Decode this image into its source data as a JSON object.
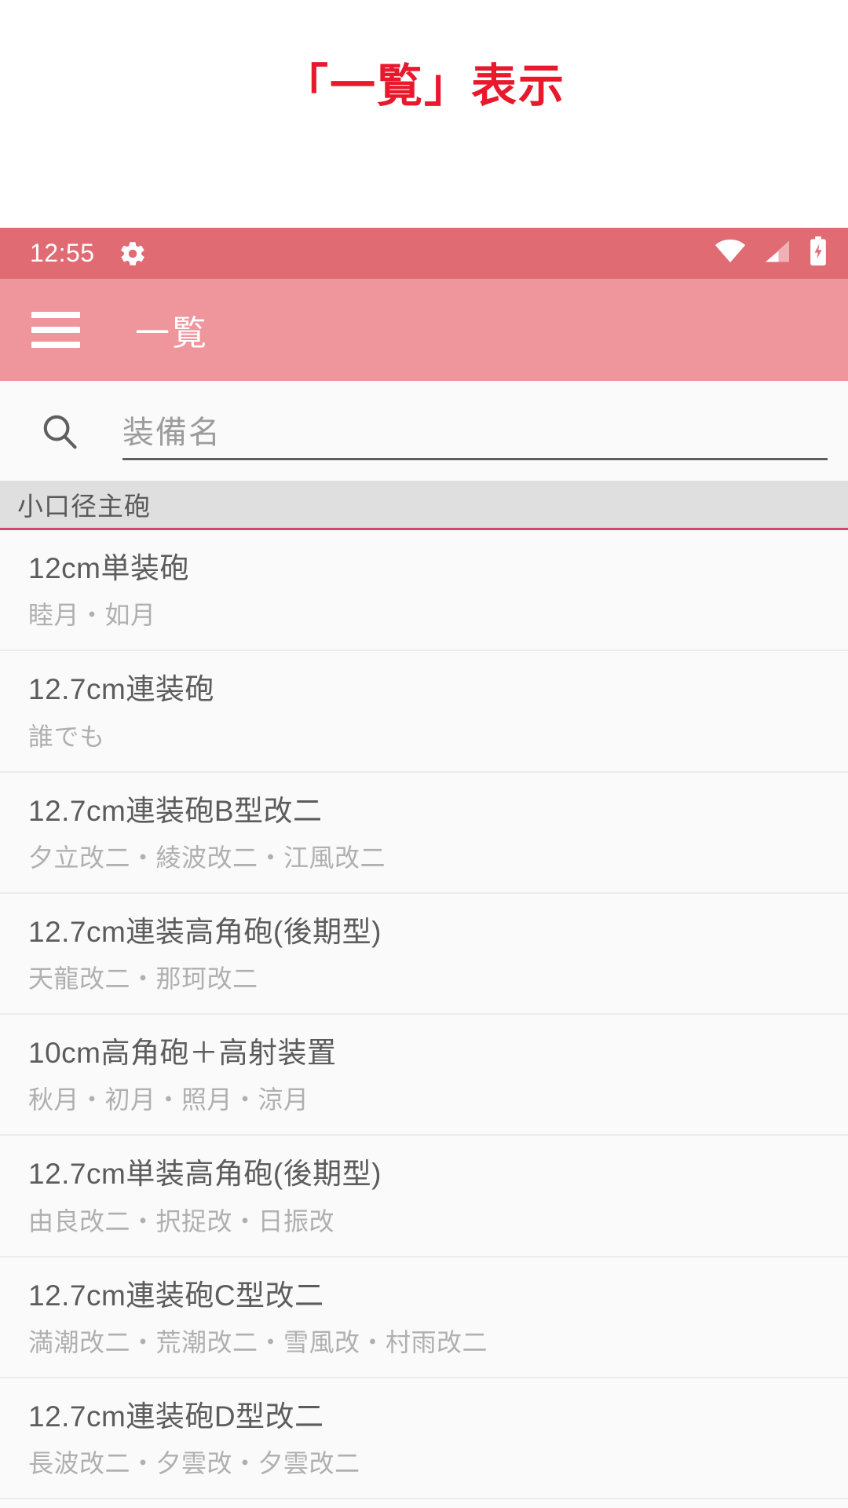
{
  "caption": {
    "title": "「一覧」表示",
    "color": "#e8192c"
  },
  "status_bar": {
    "time": "12:55",
    "icons": [
      "gear-icon",
      "wifi-icon",
      "cellular-signal-icon",
      "battery-charging-icon"
    ],
    "background": "#e06b72"
  },
  "app_bar": {
    "menu_icon": "hamburger-menu-icon",
    "title": "一覧",
    "background": "#ef969c"
  },
  "search": {
    "icon": "search-icon",
    "placeholder": "装備名",
    "value": ""
  },
  "sections": [
    {
      "label": "小口径主砲",
      "accent": "#d5456f",
      "items": [
        {
          "name": "12cm単装砲",
          "sub": "睦月・如月"
        },
        {
          "name": "12.7cm連装砲",
          "sub": "誰でも"
        },
        {
          "name": "12.7cm連装砲B型改二",
          "sub": "夕立改二・綾波改二・江風改二"
        },
        {
          "name": "12.7cm連装高角砲(後期型)",
          "sub": "天龍改二・那珂改二"
        },
        {
          "name": "10cm高角砲＋高射装置",
          "sub": "秋月・初月・照月・涼月"
        },
        {
          "name": "12.7cm単装高角砲(後期型)",
          "sub": "由良改二・択捉改・日振改"
        },
        {
          "name": "12.7cm連装砲C型改二",
          "sub": "満潮改二・荒潮改二・雪風改・村雨改二"
        },
        {
          "name": "12.7cm連装砲D型改二",
          "sub": "長波改二・夕雲改・夕雲改二"
        }
      ]
    }
  ]
}
